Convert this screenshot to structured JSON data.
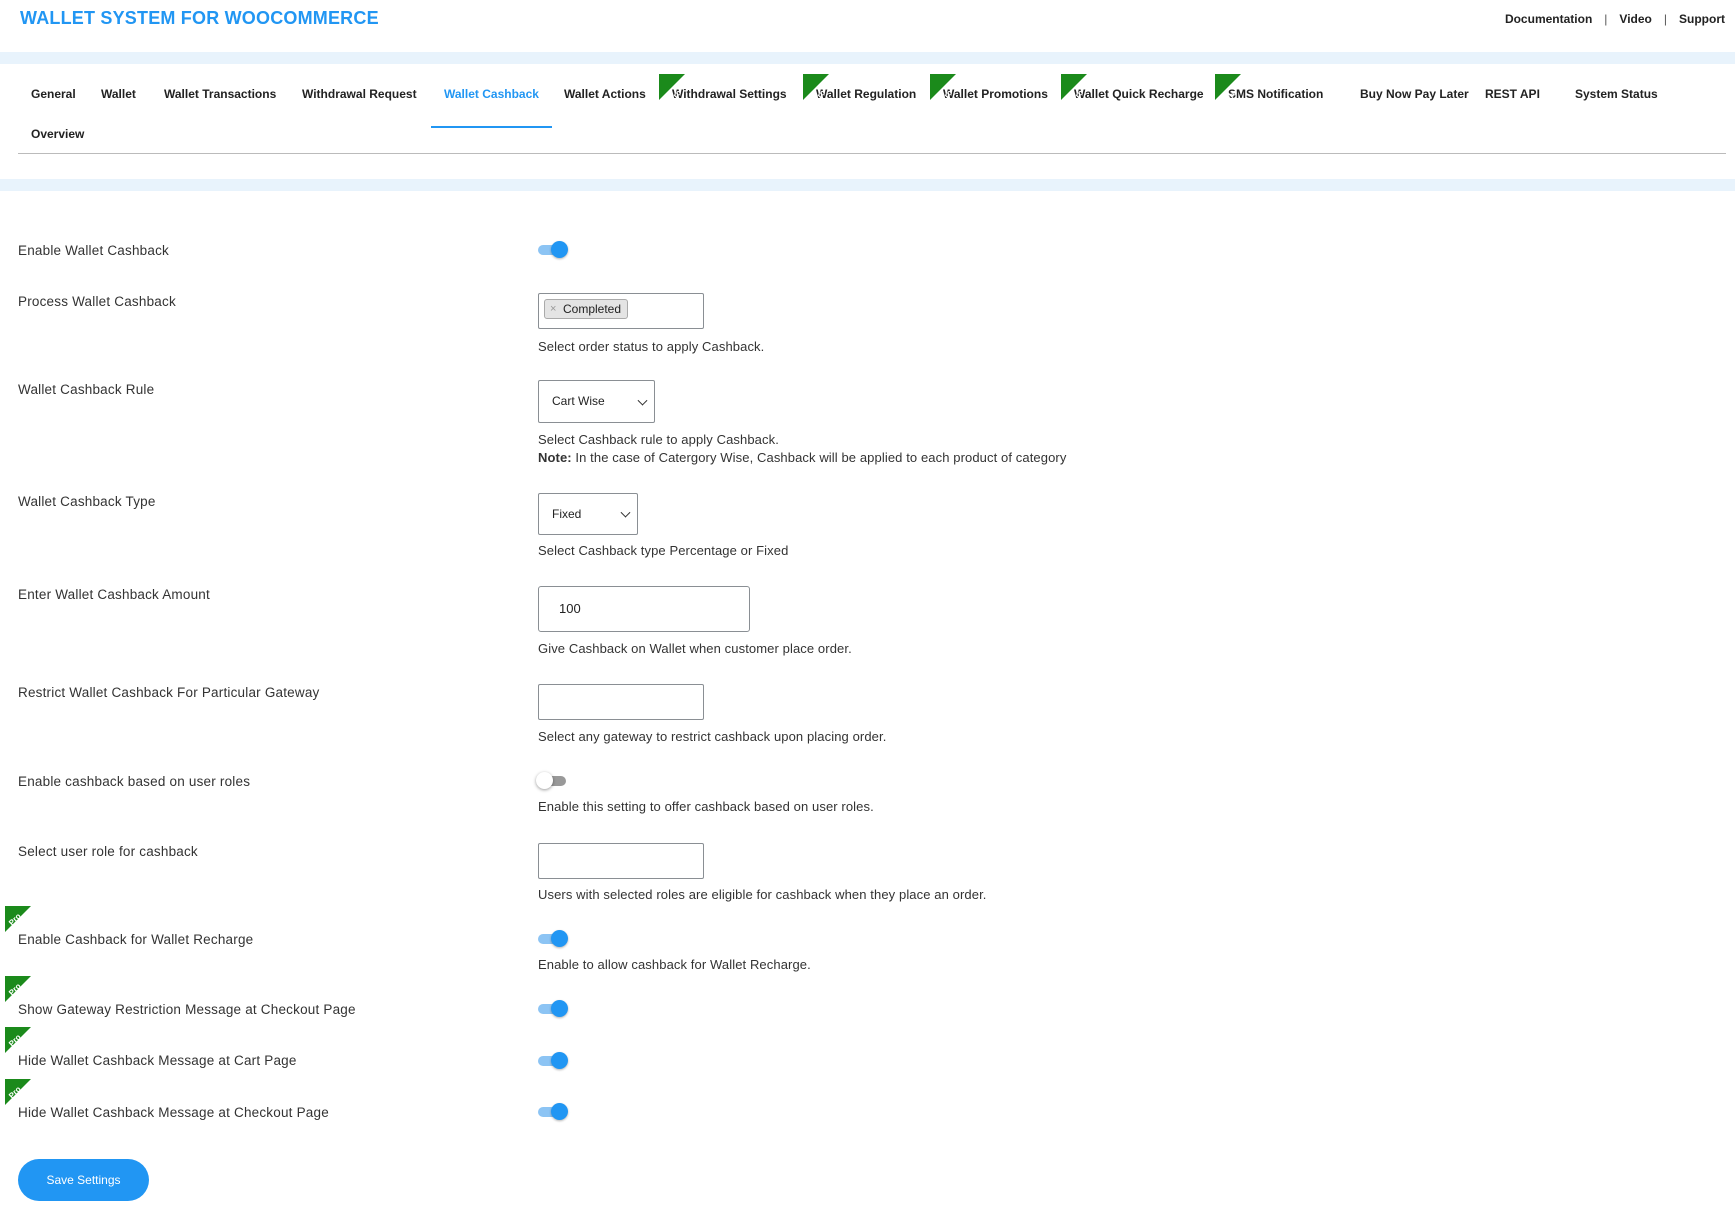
{
  "app": {
    "title": "WALLET SYSTEM FOR WOOCOMMERCE"
  },
  "toplinks": {
    "documentation": "Documentation",
    "video": "Video",
    "support": "Support",
    "separator": "|"
  },
  "pro_badge": "Pro",
  "tabs": [
    {
      "label": "General"
    },
    {
      "label": "Wallet"
    },
    {
      "label": "Wallet Transactions"
    },
    {
      "label": "Withdrawal Request"
    },
    {
      "label": "Wallet Cashback",
      "active": true
    },
    {
      "label": "Wallet Actions"
    },
    {
      "label": "Withdrawal Settings",
      "pro": true
    },
    {
      "label": "Wallet Regulation",
      "pro": true
    },
    {
      "label": "Wallet Promotions",
      "pro": true
    },
    {
      "label": "Wallet Quick Recharge",
      "pro": true
    },
    {
      "label": "SMS Notification",
      "pro": true
    },
    {
      "label": "Buy Now Pay Later"
    },
    {
      "label": "REST API"
    },
    {
      "label": "System Status"
    },
    {
      "label": "Overview"
    }
  ],
  "settings": {
    "enable_cashback": {
      "label": "Enable Wallet Cashback",
      "enabled": true
    },
    "process_cashback": {
      "label": "Process Wallet Cashback",
      "selected": "Completed",
      "remove": "×",
      "help": "Select order status to apply Cashback."
    },
    "cashback_rule": {
      "label": "Wallet Cashback Rule",
      "value": "Cart Wise",
      "help": "Select Cashback rule to apply Cashback.",
      "note_label": "Note:",
      "note": " In the case of Catergory Wise, Cashback will be applied to each product of category"
    },
    "cashback_type": {
      "label": "Wallet Cashback Type",
      "value": "Fixed",
      "help": "Select Cashback type Percentage or Fixed"
    },
    "cashback_amount": {
      "label": "Enter Wallet Cashback Amount",
      "value": "100",
      "help": "Give Cashback on Wallet when customer place order."
    },
    "restrict_gateway": {
      "label": "Restrict Wallet Cashback For Particular Gateway",
      "value": "",
      "help": "Select any gateway to restrict cashback upon placing order."
    },
    "user_roles": {
      "label": "Enable cashback based on user roles",
      "enabled": false,
      "help": "Enable this setting to offer cashback based on user roles."
    },
    "select_role": {
      "label": "Select user role for cashback",
      "value": "",
      "help": "Users with selected roles are eligible for cashback when they place an order."
    },
    "recharge_cashback": {
      "label": "Enable Cashback for Wallet Recharge",
      "enabled": true,
      "pro": true,
      "help": "Enable to allow cashback for Wallet Recharge."
    },
    "gateway_message": {
      "label": "Show Gateway Restriction Message at Checkout Page",
      "enabled": true,
      "pro": true
    },
    "hide_cart_message": {
      "label": "Hide Wallet Cashback Message at Cart Page",
      "enabled": true,
      "pro": true
    },
    "hide_checkout_message": {
      "label": "Hide Wallet Cashback Message at Checkout Page",
      "enabled": true,
      "pro": true
    }
  },
  "save_button": "Save Settings",
  "colors": {
    "accent": "#2196f3",
    "pro_badge": "#1b8a1b",
    "stripe": "#e8f3fc"
  }
}
